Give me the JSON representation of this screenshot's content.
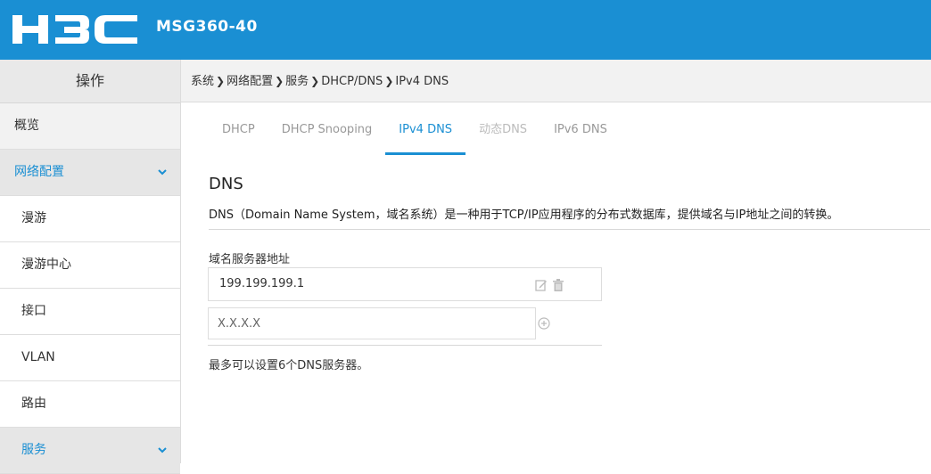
{
  "header": {
    "logo": "H3C",
    "model": "MSG360-40",
    "bg_color": "#1a8fd3"
  },
  "sidebar": {
    "title": "操作",
    "items": [
      {
        "label": "概览"
      },
      {
        "label": "网络配置"
      },
      {
        "label": "漫游"
      },
      {
        "label": "漫游中心"
      },
      {
        "label": "接口"
      },
      {
        "label": "VLAN"
      },
      {
        "label": "路由"
      },
      {
        "label": "服务"
      }
    ]
  },
  "breadcrumb": [
    "系统",
    "网络配置",
    "服务",
    "DHCP/DNS",
    "IPv4 DNS"
  ],
  "tabs": [
    {
      "label": "DHCP"
    },
    {
      "label": "DHCP Snooping"
    },
    {
      "label": "IPv4 DNS"
    },
    {
      "label": "动态DNS"
    },
    {
      "label": "IPv6 DNS"
    }
  ],
  "main": {
    "title": "DNS",
    "description": "DNS（Domain Name System，域名系统）是一种用于TCP/IP应用程序的分布式数据库，提供域名与IP地址之间的转换。",
    "field_label": "域名服务器地址",
    "servers": [
      "199.199.199.1"
    ],
    "input_placeholder": "X.X.X.X",
    "hint": "最多可以设置6个DNS服务器。"
  },
  "icons": {
    "edit": "edit-icon",
    "delete": "trash-icon",
    "add": "plus-circle-icon",
    "expand": "chevron-down-icon"
  },
  "colors": {
    "accent": "#1a8fd3"
  }
}
